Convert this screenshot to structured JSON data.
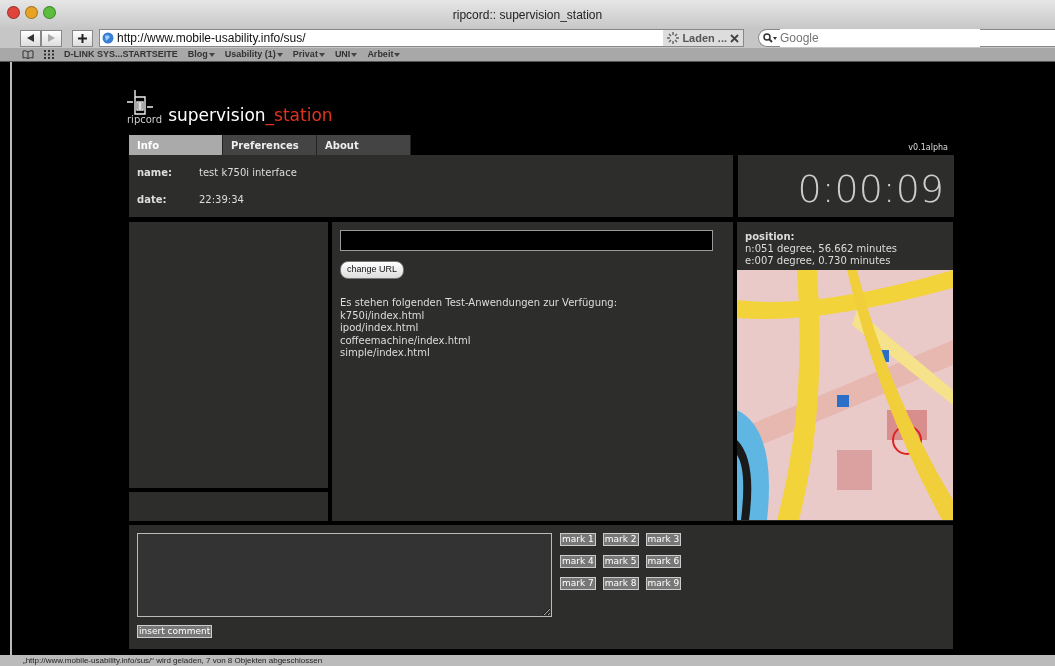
{
  "window": {
    "title": "ripcord:: supervision_station"
  },
  "toolbar": {
    "url": "http://www.mobile-usability.info/sus/",
    "loading_label": "Laden ...",
    "search_placeholder": "Google"
  },
  "bookmarks": [
    {
      "label": "D-LINK SYS...STARTSEITE",
      "dropdown": false
    },
    {
      "label": "Blog",
      "dropdown": true
    },
    {
      "label": "Usability (1)",
      "dropdown": true
    },
    {
      "label": "Privat",
      "dropdown": true
    },
    {
      "label": "UNI",
      "dropdown": true
    },
    {
      "label": "Arbeit",
      "dropdown": true
    }
  ],
  "app": {
    "logo_text": "ripcord",
    "title": "supervision",
    "title_accent": "_station",
    "version": "v0.1alpha"
  },
  "tabs": [
    {
      "label": "Info",
      "selected": true
    },
    {
      "label": "Preferences",
      "selected": false
    },
    {
      "label": "About",
      "selected": false
    }
  ],
  "info": [
    {
      "label": "name:",
      "value": "test k750i interface"
    },
    {
      "label": "date:",
      "value": "22:39:34"
    }
  ],
  "timer": "0:00:09",
  "change_url_button": "change URL",
  "apps_intro": "Es stehen folgenden Test-Anwendungen zur Verfügung:",
  "apps": [
    "k750i/index.html",
    "ipod/index.html",
    "coffeemachine/index.html",
    "simple/index.html"
  ],
  "position": {
    "label": "position:",
    "lines": [
      "n:051 degree, 56.662 minutes",
      "e:007 degree, 0.730 minutes"
    ]
  },
  "mark_buttons": [
    "mark 1",
    "mark 2",
    "mark 3",
    "mark 4",
    "mark 5",
    "mark 6",
    "mark 7",
    "mark 8",
    "mark 9"
  ],
  "comment_button": "insert comment",
  "status_bar": "„http://www.mobile-usability.info/sus/“ wird geladen, 7 von 8 Objekten abgeschlossen"
}
